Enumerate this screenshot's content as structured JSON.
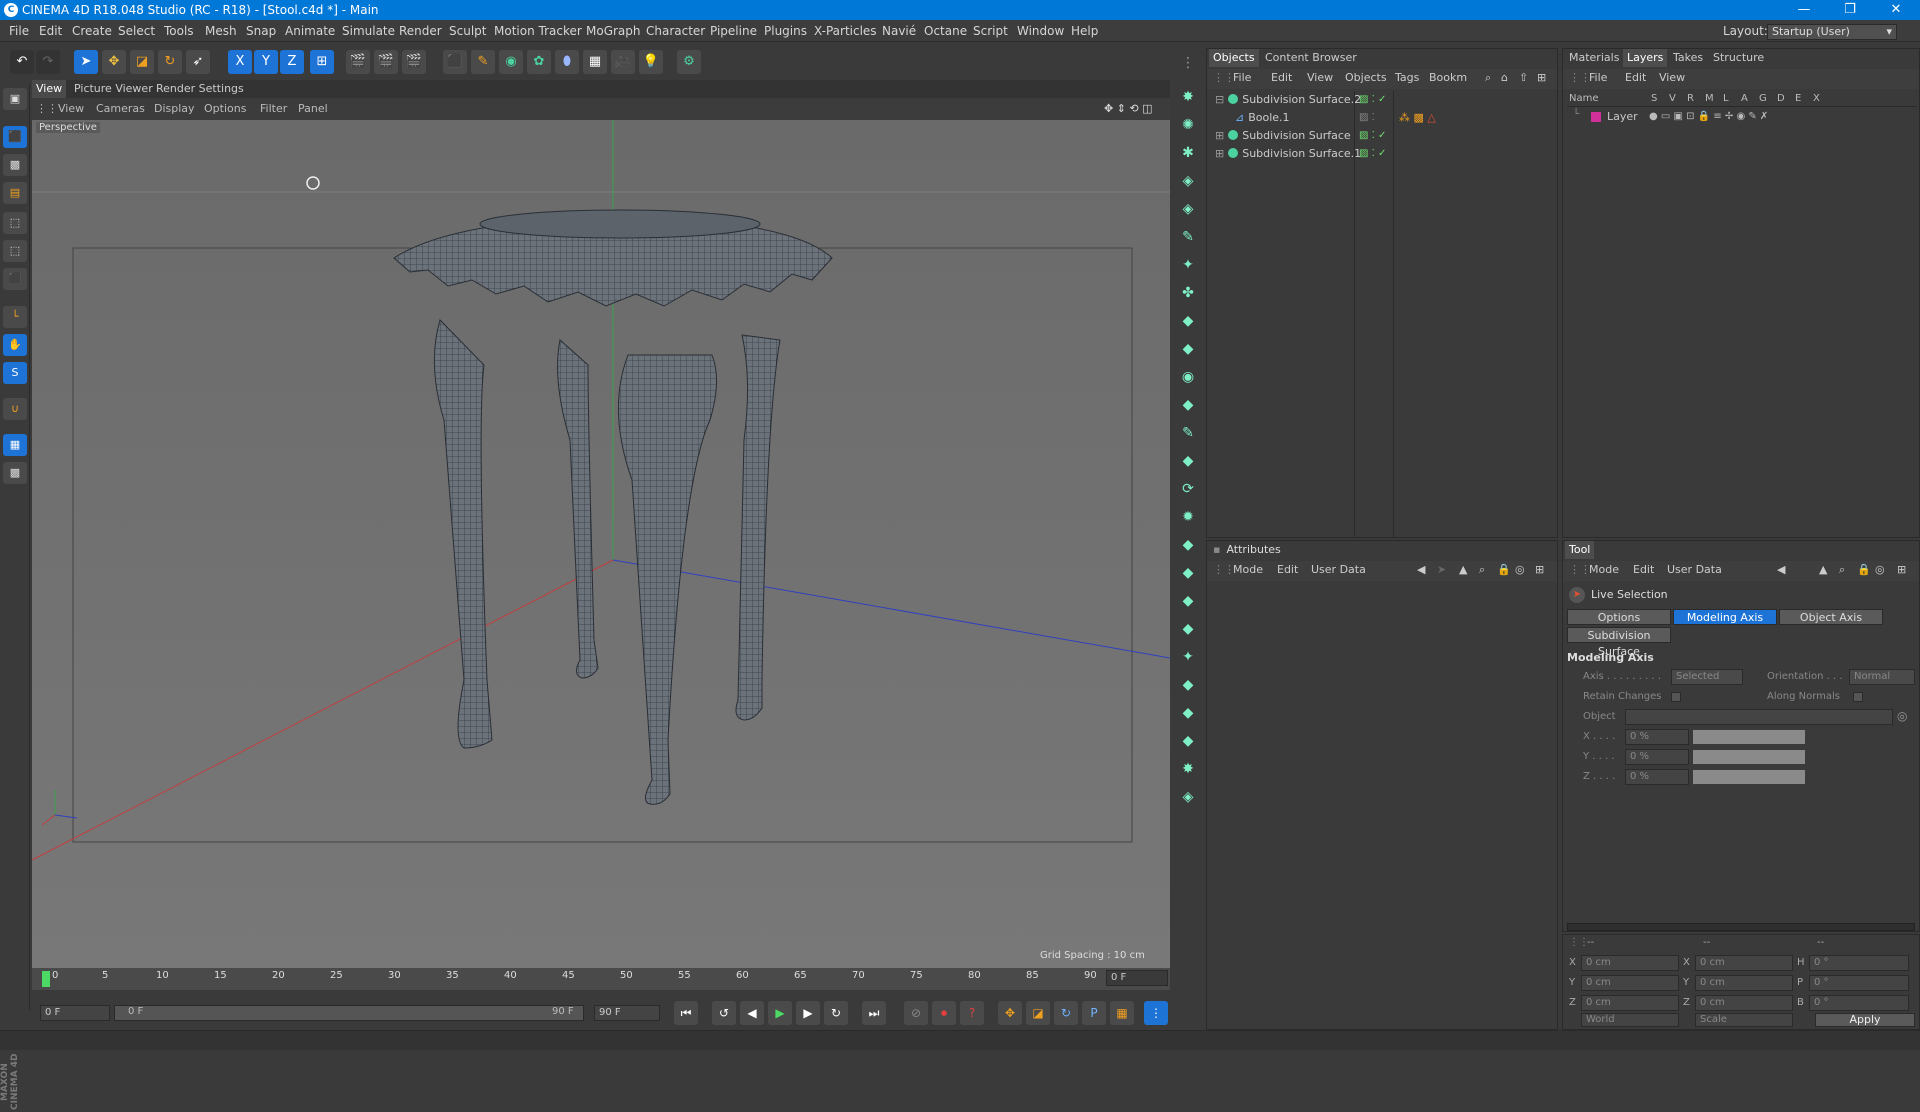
{
  "window": {
    "title": "CINEMA 4D R18.048 Studio (RC - R18) - [Stool.c4d *] - Main",
    "minimize": "—",
    "maximize": "❐",
    "close": "✕"
  },
  "menubar": {
    "items": [
      "File",
      "Edit",
      "Create",
      "Select",
      "Tools",
      "Mesh",
      "Snap",
      "Animate",
      "Simulate",
      "Render",
      "Sculpt",
      "Motion Tracker",
      "MoGraph",
      "Character",
      "Pipeline",
      "Plugins",
      "X-Particles",
      "Navié",
      "Octane",
      "Script",
      "Window",
      "Help"
    ],
    "layout_label": "Layout:",
    "layout_value": "Startup (User)"
  },
  "viewport": {
    "tabs": [
      "View",
      "Picture Viewer",
      "Render Settings"
    ],
    "menu": [
      "View",
      "Cameras",
      "Display",
      "Options",
      "Filter",
      "Panel"
    ],
    "camera_label": "Perspective",
    "grid_spacing": "Grid Spacing : 10 cm"
  },
  "objects_panel": {
    "tabs": [
      "Objects",
      "Content Browser"
    ],
    "menu": [
      "File",
      "Edit",
      "View",
      "Objects",
      "Tags",
      "Bookm"
    ],
    "items": [
      {
        "name": "Subdivision Surface.2"
      },
      {
        "name": "Boole.1"
      },
      {
        "name": "Subdivision Surface"
      },
      {
        "name": "Subdivision Surface.1"
      }
    ]
  },
  "layers_panel": {
    "tabs": [
      "Materials",
      "Layers",
      "Takes",
      "Structure"
    ],
    "menu": [
      "File",
      "Edit",
      "View"
    ],
    "columns": [
      "Name",
      "S",
      "V",
      "R",
      "M",
      "L",
      "A",
      "G",
      "D",
      "E",
      "X"
    ],
    "layer_name": "Layer",
    "layer_color": "#d0309a"
  },
  "attributes_panel": {
    "title": "Attributes",
    "menu": [
      "Mode",
      "Edit",
      "User Data"
    ]
  },
  "tool_panel": {
    "title": "Tool",
    "menu": [
      "Mode",
      "Edit",
      "User Data"
    ],
    "tool_name": "Live Selection",
    "buttons": [
      "Options",
      "Modeling Axis",
      "Object Axis"
    ],
    "active_button": "Modeling Axis",
    "sub_tab": "Subdivision Surface",
    "section": "Modeling Axis",
    "axis_label": "Axis . . . . . . . . .",
    "axis_value": "Selected",
    "orientation_label": "Orientation . . .",
    "orientation_value": "Normal",
    "retain_label": "Retain Changes",
    "along_label": "Along Normals",
    "object_label": "Object",
    "x_label": "X . . . .",
    "y_label": "Y . . . .",
    "z_label": "Z . . . .",
    "x_value": "0 %",
    "y_value": "0 %",
    "z_value": "0 %"
  },
  "coords": {
    "headers": [
      "--",
      "--",
      "--"
    ],
    "rows": [
      {
        "a": "X",
        "av": "0 cm",
        "b": "X",
        "bv": "0 cm",
        "c": "H",
        "cv": "0 °"
      },
      {
        "a": "Y",
        "av": "0 cm",
        "b": "Y",
        "bv": "0 cm",
        "c": "P",
        "cv": "0 °"
      },
      {
        "a": "Z",
        "av": "0 cm",
        "b": "Z",
        "bv": "0 cm",
        "c": "B",
        "cv": "0 °"
      }
    ],
    "world": "World",
    "scale": "Scale",
    "apply": "Apply"
  },
  "timeline": {
    "ticks": [
      "0",
      "5",
      "10",
      "15",
      "20",
      "25",
      "30",
      "35",
      "40",
      "45",
      "50",
      "55",
      "60",
      "65",
      "70",
      "75",
      "80",
      "85",
      "90"
    ],
    "current_frame": "0 F",
    "start_field": "0 F",
    "range_start": "0 F",
    "range_end": "90 F",
    "end_field": "90 F"
  },
  "branding": "MAXON CINEMA 4D"
}
